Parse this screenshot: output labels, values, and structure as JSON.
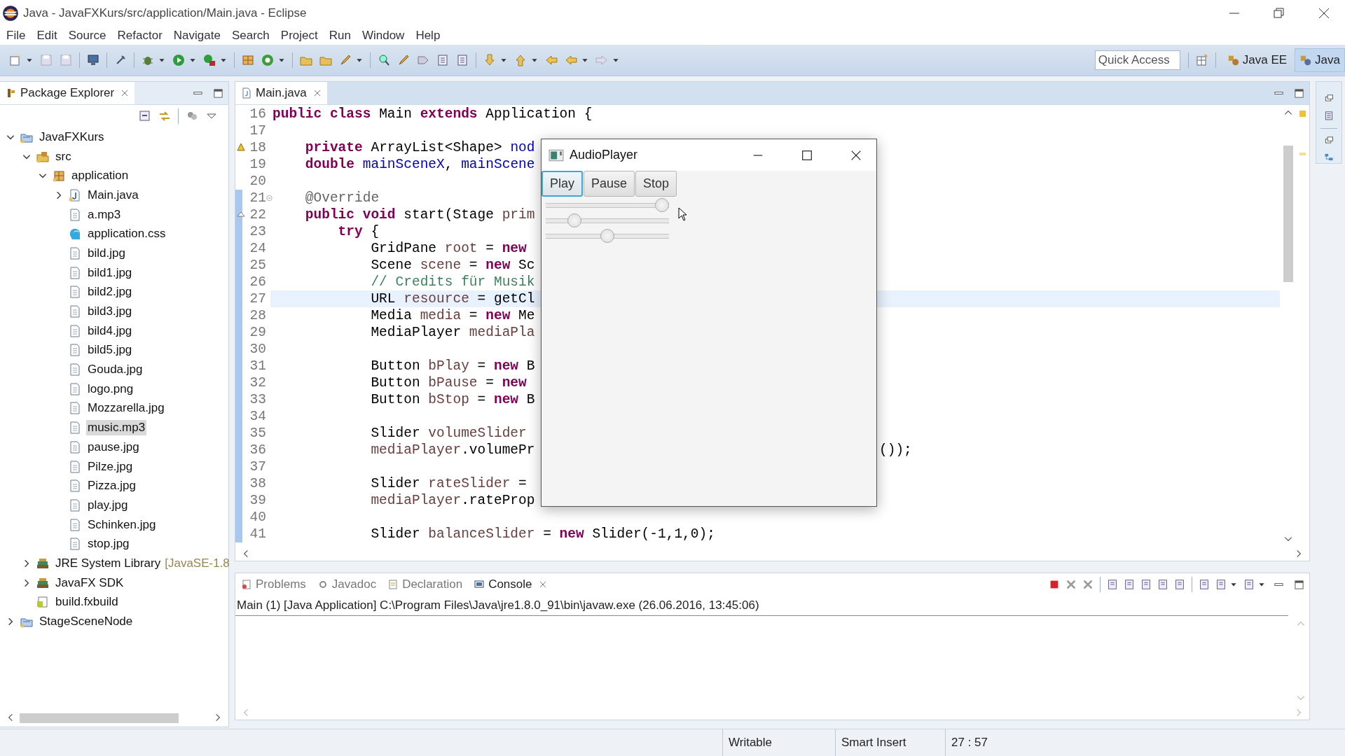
{
  "window": {
    "title": "Java - JavaFXKurs/src/application/Main.java - Eclipse"
  },
  "menu": [
    "File",
    "Edit",
    "Source",
    "Refactor",
    "Navigate",
    "Search",
    "Project",
    "Run",
    "Window",
    "Help"
  ],
  "quick_access": {
    "placeholder": "Quick Access"
  },
  "perspectives": [
    {
      "label": "Java EE",
      "selected": false
    },
    {
      "label": "Java",
      "selected": true
    }
  ],
  "package_explorer": {
    "title": "Package Explorer",
    "items": [
      {
        "label": "JavaFXKurs",
        "kind": "project",
        "expanded": true,
        "selected": false,
        "children": [
          {
            "label": "src",
            "kind": "source-folder",
            "expanded": true,
            "selected": false,
            "children": [
              {
                "label": "application",
                "kind": "package",
                "expanded": true,
                "selected": false,
                "children": [
                  {
                    "label": "Main.java",
                    "kind": "java",
                    "expanded": false,
                    "selected": false
                  },
                  {
                    "label": "a.mp3",
                    "kind": "file",
                    "selected": false
                  },
                  {
                    "label": "application.css",
                    "kind": "css",
                    "selected": false
                  },
                  {
                    "label": "bild.jpg",
                    "kind": "file",
                    "selected": false
                  },
                  {
                    "label": "bild1.jpg",
                    "kind": "file",
                    "selected": false
                  },
                  {
                    "label": "bild2.jpg",
                    "kind": "file",
                    "selected": false
                  },
                  {
                    "label": "bild3.jpg",
                    "kind": "file",
                    "selected": false
                  },
                  {
                    "label": "bild4.jpg",
                    "kind": "file",
                    "selected": false
                  },
                  {
                    "label": "bild5.jpg",
                    "kind": "file",
                    "selected": false
                  },
                  {
                    "label": "Gouda.jpg",
                    "kind": "file",
                    "selected": false
                  },
                  {
                    "label": "logo.png",
                    "kind": "file",
                    "selected": false
                  },
                  {
                    "label": "Mozzarella.jpg",
                    "kind": "file",
                    "selected": false
                  },
                  {
                    "label": "music.mp3",
                    "kind": "file",
                    "selected": true
                  },
                  {
                    "label": "pause.jpg",
                    "kind": "file",
                    "selected": false
                  },
                  {
                    "label": "Pilze.jpg",
                    "kind": "file",
                    "selected": false
                  },
                  {
                    "label": "Pizza.jpg",
                    "kind": "file",
                    "selected": false
                  },
                  {
                    "label": "play.jpg",
                    "kind": "file",
                    "selected": false
                  },
                  {
                    "label": "Schinken.jpg",
                    "kind": "file",
                    "selected": false
                  },
                  {
                    "label": "stop.jpg",
                    "kind": "file",
                    "selected": false
                  }
                ]
              }
            ]
          },
          {
            "label": "JRE System Library",
            "decoration": "[JavaSE-1.8",
            "kind": "library",
            "expanded": false,
            "selected": false
          },
          {
            "label": "JavaFX SDK",
            "kind": "library",
            "expanded": false,
            "selected": false
          },
          {
            "label": "build.fxbuild",
            "kind": "build",
            "selected": false
          }
        ]
      },
      {
        "label": "StageSceneNode",
        "kind": "project",
        "expanded": false,
        "selected": false
      }
    ]
  },
  "editor": {
    "tab": "Main.java",
    "lines": [
      {
        "number": "16",
        "kind": "plain",
        "current": false,
        "range": false,
        "tokens": [
          {
            "text": "public class",
            "kind": "keyword"
          },
          {
            "text": " Main ",
            "kind": "plain"
          },
          {
            "text": "extends",
            "kind": "keyword"
          },
          {
            "text": " Application {",
            "kind": "plain"
          }
        ]
      },
      {
        "number": "17",
        "kind": "plain",
        "current": false,
        "range": false
      },
      {
        "number": "18",
        "kind": "warning",
        "current": false,
        "range": false,
        "tokens": [
          {
            "text": "    private",
            "kind": "keyword"
          },
          {
            "text": " ArrayList<Shape> ",
            "kind": "plain"
          },
          {
            "text": "nod",
            "kind": "field"
          }
        ]
      },
      {
        "number": "19",
        "kind": "plain",
        "current": false,
        "range": false,
        "tokens": [
          {
            "text": "    double",
            "kind": "keyword"
          },
          {
            "text": " mainSceneX",
            "kind": "field"
          },
          {
            "text": ", ",
            "kind": "plain"
          },
          {
            "text": "mainScene",
            "kind": "field"
          }
        ]
      },
      {
        "number": "20",
        "kind": "plain",
        "current": false,
        "range": false
      },
      {
        "number": "21",
        "kind": "fold",
        "current": false,
        "range": true,
        "tokens": [
          {
            "text": "    @Override",
            "kind": "annotation"
          }
        ]
      },
      {
        "number": "22",
        "kind": "override",
        "current": false,
        "range": true,
        "tokens": [
          {
            "text": "    public void",
            "kind": "keyword"
          },
          {
            "text": " start(Stage ",
            "kind": "plain"
          },
          {
            "text": "prim",
            "kind": "param"
          }
        ]
      },
      {
        "number": "23",
        "kind": "plain",
        "current": false,
        "range": true,
        "tokens": [
          {
            "text": "        try",
            "kind": "keyword"
          },
          {
            "text": " {",
            "kind": "plain"
          }
        ]
      },
      {
        "number": "24",
        "kind": "plain",
        "current": false,
        "range": true,
        "tokens": [
          {
            "text": "            GridPane ",
            "kind": "plain"
          },
          {
            "text": "root",
            "kind": "local"
          },
          {
            "text": " = ",
            "kind": "plain"
          },
          {
            "text": "new",
            "kind": "keyword"
          }
        ]
      },
      {
        "number": "25",
        "kind": "plain",
        "current": false,
        "range": true,
        "tokens": [
          {
            "text": "            Scene ",
            "kind": "plain"
          },
          {
            "text": "scene",
            "kind": "local"
          },
          {
            "text": " = ",
            "kind": "plain"
          },
          {
            "text": "new",
            "kind": "keyword"
          },
          {
            "text": " Sc",
            "kind": "plain"
          }
        ]
      },
      {
        "number": "26",
        "kind": "plain",
        "current": false,
        "range": true,
        "tokens": [
          {
            "text": "            // Credits für Musik",
            "kind": "comment"
          }
        ]
      },
      {
        "number": "27",
        "kind": "plain",
        "current": true,
        "range": true,
        "tokens": [
          {
            "text": "            URL ",
            "kind": "plain"
          },
          {
            "text": "resource",
            "kind": "local"
          },
          {
            "text": " = getCl",
            "kind": "plain"
          }
        ]
      },
      {
        "number": "28",
        "kind": "plain",
        "current": false,
        "range": true,
        "tokens": [
          {
            "text": "            Media ",
            "kind": "plain"
          },
          {
            "text": "media",
            "kind": "local"
          },
          {
            "text": " = ",
            "kind": "plain"
          },
          {
            "text": "new",
            "kind": "keyword"
          },
          {
            "text": " Me",
            "kind": "plain"
          }
        ]
      },
      {
        "number": "29",
        "kind": "plain",
        "current": false,
        "range": true,
        "tokens": [
          {
            "text": "            MediaPlayer ",
            "kind": "plain"
          },
          {
            "text": "mediaPla",
            "kind": "local"
          }
        ]
      },
      {
        "number": "30",
        "kind": "plain",
        "current": false,
        "range": true
      },
      {
        "number": "31",
        "kind": "plain",
        "current": false,
        "range": true,
        "tokens": [
          {
            "text": "            Button ",
            "kind": "plain"
          },
          {
            "text": "bPlay",
            "kind": "local"
          },
          {
            "text": " = ",
            "kind": "plain"
          },
          {
            "text": "new",
            "kind": "keyword"
          },
          {
            "text": " B",
            "kind": "plain"
          }
        ]
      },
      {
        "number": "32",
        "kind": "plain",
        "current": false,
        "range": true,
        "tokens": [
          {
            "text": "            Button ",
            "kind": "plain"
          },
          {
            "text": "bPause",
            "kind": "local"
          },
          {
            "text": " = ",
            "kind": "plain"
          },
          {
            "text": "new",
            "kind": "keyword"
          }
        ]
      },
      {
        "number": "33",
        "kind": "plain",
        "current": false,
        "range": true,
        "tokens": [
          {
            "text": "            Button ",
            "kind": "plain"
          },
          {
            "text": "bStop",
            "kind": "local"
          },
          {
            "text": " = ",
            "kind": "plain"
          },
          {
            "text": "new",
            "kind": "keyword"
          },
          {
            "text": " B",
            "kind": "plain"
          }
        ]
      },
      {
        "number": "34",
        "kind": "plain",
        "current": false,
        "range": true
      },
      {
        "number": "35",
        "kind": "plain",
        "current": false,
        "range": true,
        "tokens": [
          {
            "text": "            Slider ",
            "kind": "plain"
          },
          {
            "text": "volumeSlider",
            "kind": "local"
          }
        ]
      },
      {
        "number": "36",
        "kind": "plain",
        "current": false,
        "range": true,
        "tokens": [
          {
            "text": "            mediaPlayer",
            "kind": "local"
          },
          {
            "text": ".volumePr",
            "kind": "plain"
          }
        ],
        "tail": "());"
      },
      {
        "number": "37",
        "kind": "plain",
        "current": false,
        "range": true
      },
      {
        "number": "38",
        "kind": "plain",
        "current": false,
        "range": true,
        "tokens": [
          {
            "text": "            Slider ",
            "kind": "plain"
          },
          {
            "text": "rateSlider",
            "kind": "local"
          },
          {
            "text": " =",
            "kind": "plain"
          }
        ]
      },
      {
        "number": "39",
        "kind": "plain",
        "current": false,
        "range": true,
        "tokens": [
          {
            "text": "            mediaPlayer",
            "kind": "local"
          },
          {
            "text": ".rateProp",
            "kind": "plain"
          }
        ]
      },
      {
        "number": "40",
        "kind": "plain",
        "current": false,
        "range": true
      },
      {
        "number": "41",
        "kind": "plain",
        "current": false,
        "range": true,
        "tokens": [
          {
            "text": "            Slider ",
            "kind": "plain"
          },
          {
            "text": "balanceSlider",
            "kind": "local"
          },
          {
            "text": " = ",
            "kind": "plain"
          },
          {
            "text": "new",
            "kind": "keyword"
          },
          {
            "text": " Slider(-1,1,0);",
            "kind": "plain"
          }
        ]
      }
    ]
  },
  "audio_player": {
    "title": "AudioPlayer",
    "buttons": [
      {
        "label": "Play",
        "selected": true
      },
      {
        "label": "Pause",
        "selected": false
      },
      {
        "label": "Stop",
        "selected": false
      }
    ],
    "sliders": [
      {
        "level": 1.0
      },
      {
        "level": 0.2
      },
      {
        "level": 0.5
      }
    ]
  },
  "console": {
    "tabs": [
      {
        "label": "Problems",
        "kind": "problems",
        "selected": false
      },
      {
        "label": "Javadoc",
        "kind": "javadoc",
        "selected": false
      },
      {
        "label": "Declaration",
        "kind": "declaration",
        "selected": false
      },
      {
        "label": "Console",
        "kind": "console",
        "selected": true
      }
    ],
    "text": "Main (1) [Java Application] C:\\Program Files\\Java\\jre1.8.0_91\\bin\\javaw.exe (26.06.2016, 13:45:06)"
  },
  "status_bar": [
    "Writable",
    "Smart Insert",
    "27 : 57"
  ]
}
